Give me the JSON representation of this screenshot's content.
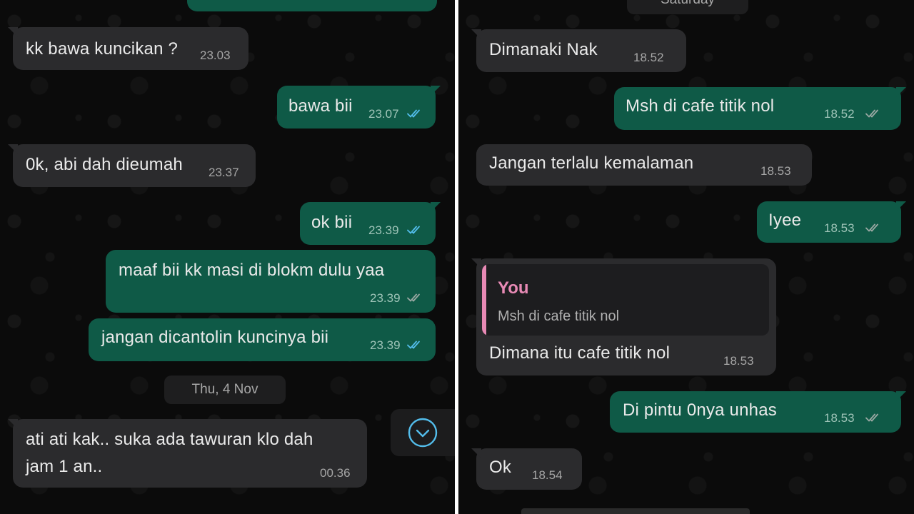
{
  "left_chat": {
    "messages": [
      {
        "text": "kk bawa kuncikan ?",
        "time": "23.03"
      },
      {
        "text": "bawa bii",
        "time": "23.07"
      },
      {
        "text": "0k, abi dah dieumah",
        "time": "23.37"
      },
      {
        "text": "ok bii",
        "time": "23.39"
      },
      {
        "text": "maaf bii kk masi di blokm dulu yaa",
        "time": "23.39"
      },
      {
        "text": "jangan dicantolin kuncinya bii",
        "time": "23.39"
      },
      {
        "text_line1": "ati ati kak.. suka ada tawuran klo dah",
        "text_line2": "jam 1 an..",
        "time": "00.36"
      }
    ],
    "date_separator": "Thu, 4 Nov",
    "scroll_down_icon": "chevron-down-circle-icon"
  },
  "right_chat": {
    "date_separator": "Saturday",
    "messages": [
      {
        "text": "Dimanaki Nak",
        "time": "18.52"
      },
      {
        "text": "Msh di cafe titik nol",
        "time": "18.52"
      },
      {
        "text": "Jangan terlalu kemalaman",
        "time": "18.53"
      },
      {
        "text": "Iyee",
        "time": "18.53"
      },
      {
        "quote_author": "You",
        "quote_text": "Msh di cafe titik nol",
        "text": "Dimana itu cafe titik nol",
        "time": "18.53"
      },
      {
        "text": "Di pintu 0nya unhas",
        "time": "18.53"
      },
      {
        "text": "Ok",
        "time": "18.54"
      }
    ]
  },
  "colors": {
    "background": "#0b0b0b",
    "incoming_bubble": "#2b2b2d",
    "outgoing_bubble": "#0f5a47",
    "read_check_blue": "#53bdeb",
    "delivered_check_gray": "#9aa8a3",
    "quote_accent_pink": "#e88ab5"
  }
}
